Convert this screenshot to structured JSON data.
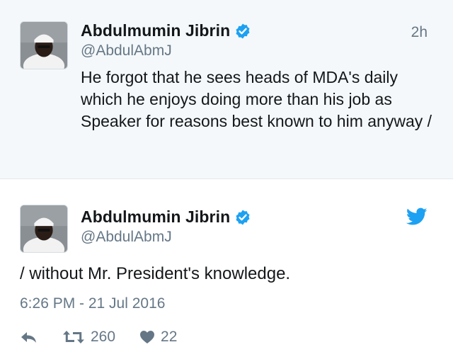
{
  "parent_tweet": {
    "display_name": "Abdulmumin Jibrin",
    "handle": "@AbdulAbmJ",
    "relative_time": "2h",
    "text": "He forgot that he sees heads of MDA's daily which he enjoys doing more than his job as Speaker for reasons best known to him anyway /",
    "verified_icon": "verified-badge",
    "avatar_icon": "profile-photo"
  },
  "main_tweet": {
    "display_name": "Abdulmumin Jibrin",
    "handle": "@AbdulAbmJ",
    "text": "/ without Mr. President's knowledge.",
    "date": "6:26 PM - 21 Jul 2016",
    "verified_icon": "verified-badge",
    "brand_icon": "twitter-bird",
    "actions": {
      "reply_icon": "reply-arrow",
      "retweet_icon": "retweet-arrows",
      "retweet_count": "260",
      "like_icon": "heart",
      "like_count": "22"
    }
  },
  "colors": {
    "parent_background": "#f5f8fa",
    "verified_blue": "#1da1f2",
    "secondary_text": "#657786",
    "primary_text": "#14171a"
  }
}
